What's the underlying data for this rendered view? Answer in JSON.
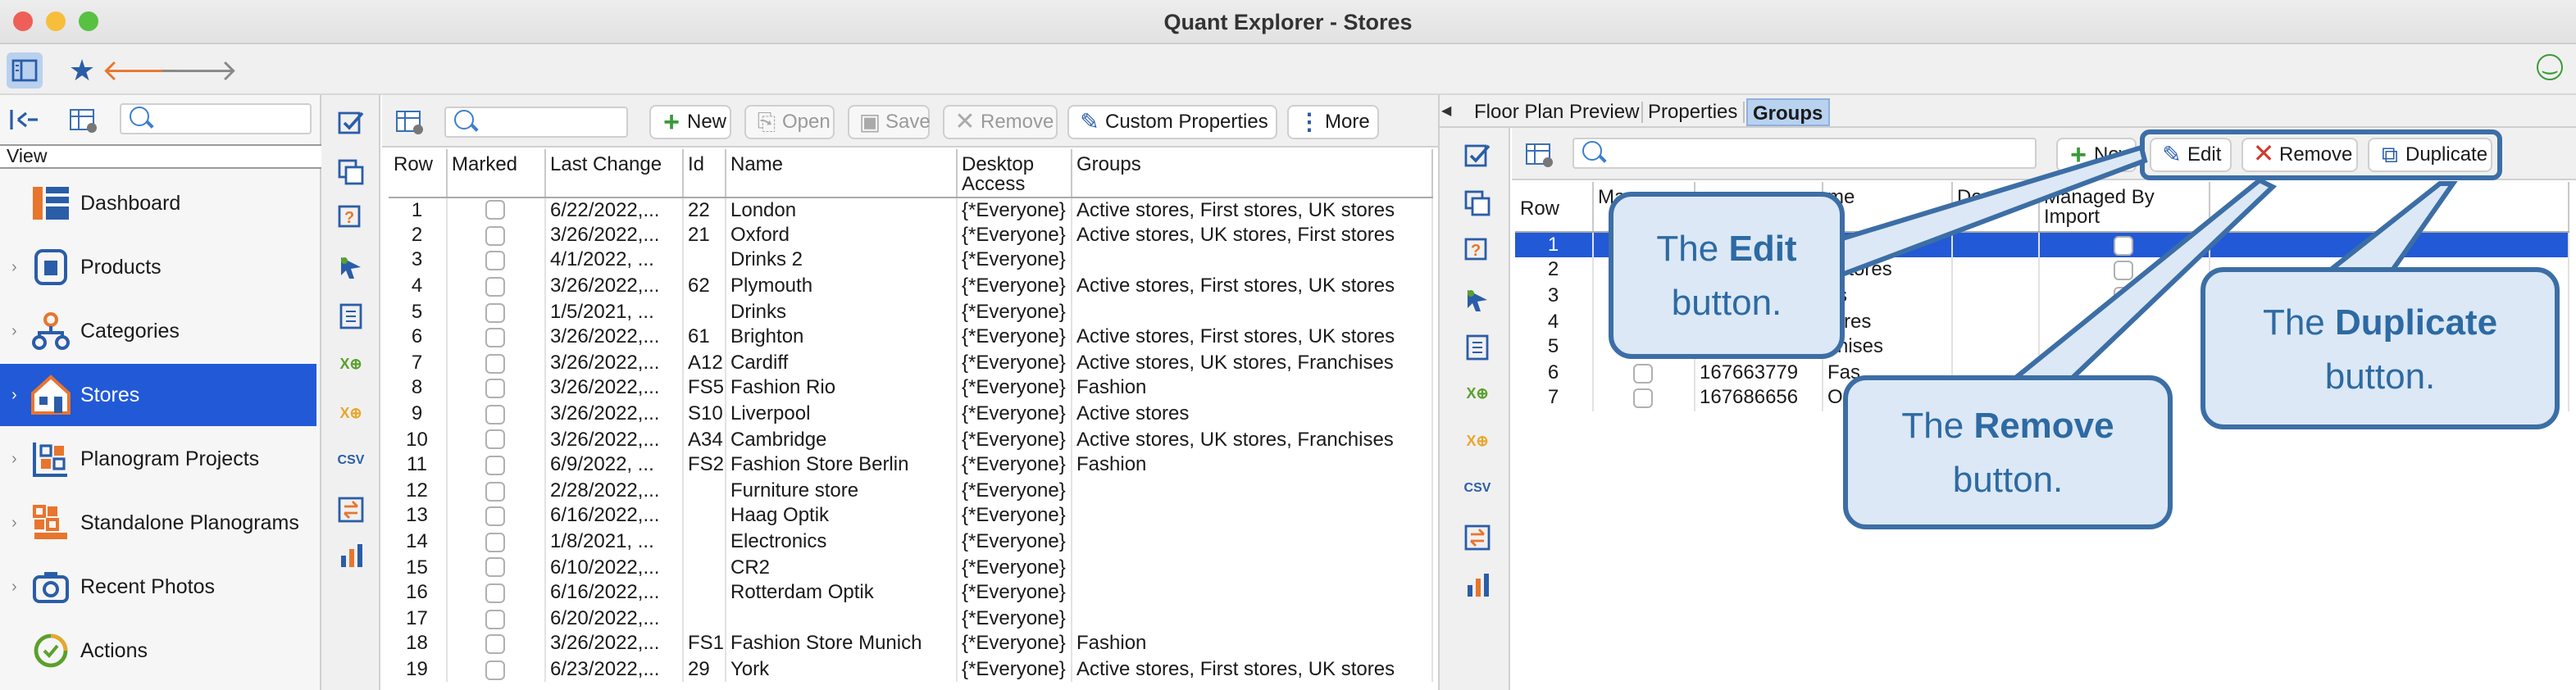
{
  "window": {
    "title": "Quant Explorer - Stores"
  },
  "left_panel": {
    "view_label": "View",
    "nav_items": [
      {
        "label": "Dashboard"
      },
      {
        "label": "Products"
      },
      {
        "label": "Categories"
      },
      {
        "label": "Stores"
      },
      {
        "label": "Planogram Projects"
      },
      {
        "label": "Standalone Planograms"
      },
      {
        "label": "Recent Photos"
      },
      {
        "label": "Actions"
      }
    ]
  },
  "middle": {
    "actions": {
      "new": "New",
      "open": "Open",
      "save": "Save",
      "remove": "Remove",
      "custom_properties": "Custom Properties",
      "more": "More"
    },
    "columns": {
      "row": "Row",
      "marked": "Marked",
      "last_change": "Last Change",
      "id": "Id",
      "name": "Name",
      "desktop_access": "Desktop Access",
      "groups": "Groups"
    },
    "rows": [
      {
        "row": "1",
        "last_change": "6/22/2022,...",
        "id": "22",
        "name": "London",
        "access": "{*Everyone}",
        "groups": "Active stores, First stores, UK stores"
      },
      {
        "row": "2",
        "last_change": "3/26/2022,...",
        "id": "21",
        "name": "Oxford",
        "access": "{*Everyone}",
        "groups": "Active stores, UK stores, First stores"
      },
      {
        "row": "3",
        "last_change": "4/1/2022, ...",
        "id": "",
        "name": "Drinks 2",
        "access": "{*Everyone}",
        "groups": ""
      },
      {
        "row": "4",
        "last_change": "3/26/2022,...",
        "id": "62",
        "name": "Plymouth",
        "access": "{*Everyone}",
        "groups": "Active stores, First stores, UK stores"
      },
      {
        "row": "5",
        "last_change": "1/5/2021, ...",
        "id": "",
        "name": "Drinks",
        "access": "{*Everyone}",
        "groups": ""
      },
      {
        "row": "6",
        "last_change": "3/26/2022,...",
        "id": "61",
        "name": "Brighton",
        "access": "{*Everyone}",
        "groups": "Active stores, First stores, UK stores"
      },
      {
        "row": "7",
        "last_change": "3/26/2022,...",
        "id": "A12",
        "name": "Cardiff",
        "access": "{*Everyone}",
        "groups": "Active stores, UK stores, Franchises"
      },
      {
        "row": "8",
        "last_change": "3/26/2022,...",
        "id": "FS5",
        "name": "Fashion Rio",
        "access": "{*Everyone}",
        "groups": "Fashion"
      },
      {
        "row": "9",
        "last_change": "3/26/2022,...",
        "id": "S10",
        "name": "Liverpool",
        "access": "{*Everyone}",
        "groups": "Active stores"
      },
      {
        "row": "10",
        "last_change": "3/26/2022,...",
        "id": "A34",
        "name": "Cambridge",
        "access": "{*Everyone}",
        "groups": "Active stores, UK stores, Franchises"
      },
      {
        "row": "11",
        "last_change": "6/9/2022, ...",
        "id": "FS2",
        "name": "Fashion Store Berlin",
        "access": "{*Everyone}",
        "groups": "Fashion"
      },
      {
        "row": "12",
        "last_change": "2/28/2022,...",
        "id": "",
        "name": "Furniture store",
        "access": "{*Everyone}",
        "groups": ""
      },
      {
        "row": "13",
        "last_change": "6/16/2022,...",
        "id": "",
        "name": "Haag Optik",
        "access": "{*Everyone}",
        "groups": ""
      },
      {
        "row": "14",
        "last_change": "1/8/2021, ...",
        "id": "",
        "name": "Electronics",
        "access": "{*Everyone}",
        "groups": ""
      },
      {
        "row": "15",
        "last_change": "6/10/2022,...",
        "id": "",
        "name": "CR2",
        "access": "{*Everyone}",
        "groups": ""
      },
      {
        "row": "16",
        "last_change": "6/16/2022,...",
        "id": "",
        "name": "Rotterdam Optik",
        "access": "{*Everyone}",
        "groups": ""
      },
      {
        "row": "17",
        "last_change": "6/20/2022,...",
        "id": "",
        "name": "",
        "access": "{*Everyone}",
        "groups": ""
      },
      {
        "row": "18",
        "last_change": "3/26/2022,...",
        "id": "FS1",
        "name": "Fashion Store Munich",
        "access": "{*Everyone}",
        "groups": "Fashion"
      },
      {
        "row": "19",
        "last_change": "6/23/2022,...",
        "id": "29",
        "name": "York",
        "access": "{*Everyone}",
        "groups": "Active stores, First stores, UK stores"
      }
    ]
  },
  "right": {
    "tabs": [
      "Floor Plan Preview",
      "Properties",
      "Groups"
    ],
    "actions": {
      "new": "New",
      "edit": "Edit",
      "remove": "Remove",
      "duplicate": "Duplicate"
    },
    "columns": {
      "row": "Row",
      "marked": "Ma",
      "id": "",
      "name": "me",
      "description": "Descript",
      "managed": "Managed By Import"
    },
    "rows": [
      {
        "row": "1",
        "id": "",
        "name": "es"
      },
      {
        "row": "2",
        "id": "",
        "name": "t stores"
      },
      {
        "row": "3",
        "id": "",
        "name": "ks"
      },
      {
        "row": "4",
        "id": "",
        "name": "tores"
      },
      {
        "row": "5",
        "id": "",
        "name": "chises"
      },
      {
        "row": "6",
        "id": "167663779",
        "name": "Fas"
      },
      {
        "row": "7",
        "id": "167686656",
        "name": "Op"
      }
    ]
  },
  "callouts": {
    "edit": {
      "prefix": "The ",
      "bold": "Edit",
      "suffix": "button."
    },
    "remove": {
      "prefix": "The ",
      "bold": "Remove",
      "suffix": "button."
    },
    "duplicate": {
      "prefix": "The ",
      "bold": "Duplicate",
      "suffix": "button."
    }
  }
}
